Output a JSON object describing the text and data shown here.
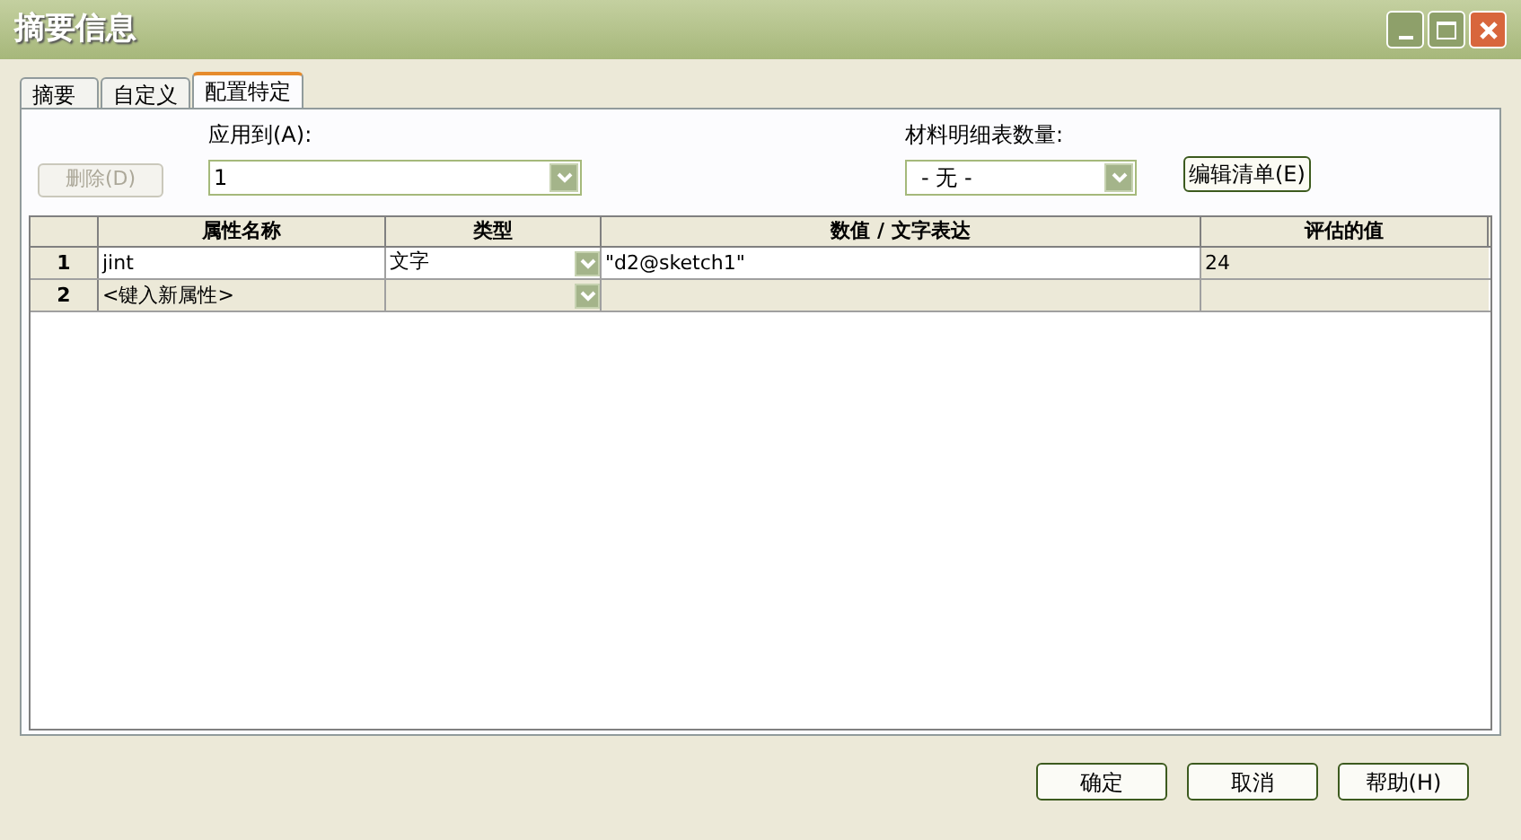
{
  "window": {
    "title": "摘要信息"
  },
  "tabs": [
    {
      "label": "摘要",
      "selected": false
    },
    {
      "label": "自定义",
      "selected": false
    },
    {
      "label": "配置特定",
      "selected": true
    }
  ],
  "delete_button": {
    "label": "删除(D)",
    "disabled": true
  },
  "apply_to": {
    "label": "应用到(A):",
    "value": "1"
  },
  "bom_quantity": {
    "label": "材料明细表数量:",
    "value": "- 无 -"
  },
  "edit_list_button": {
    "label": "编辑清单(E)"
  },
  "table": {
    "columns": [
      "属性名称",
      "类型",
      "数值 / 文字表达",
      "评估的值"
    ],
    "rows": [
      {
        "kind": "property",
        "number": "1",
        "name": "jint",
        "type": "文字",
        "value": "\"d2@sketch1\"",
        "evaluated": "24"
      },
      {
        "kind": "new",
        "number": "2",
        "name": "<键入新属性>"
      }
    ]
  },
  "buttons": [
    {
      "label": "确定"
    },
    {
      "label": "取消"
    },
    {
      "label": "帮助(H)"
    }
  ]
}
